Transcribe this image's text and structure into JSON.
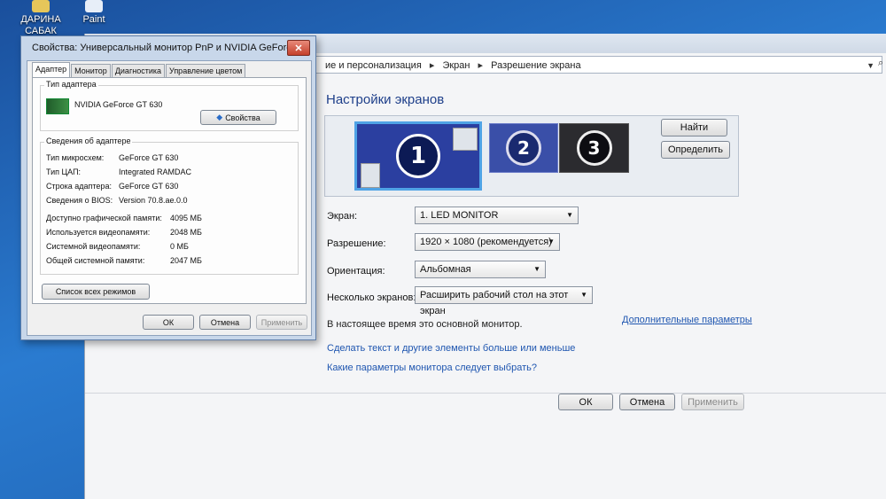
{
  "desktop": {
    "icons": [
      {
        "label": "ДАРИНА\nСАБАК",
        "name": "desktop-icon-user"
      },
      {
        "label": "Paint",
        "name": "desktop-icon-paint"
      }
    ]
  },
  "breadcrumb": {
    "item1": "ие и персонализация",
    "item2": "Экран",
    "item3": "Разрешение экрана",
    "sep": "▸"
  },
  "main": {
    "header": "Настройки экранов",
    "monitors": [
      "1",
      "2",
      "3"
    ],
    "find_button": "Найти",
    "identify_button": "Определить",
    "rows": {
      "display_label": "Экран:",
      "display_value": "1. LED MONITOR",
      "resolution_label": "Разрешение:",
      "resolution_value": "1920 × 1080 (рекомендуется)",
      "orientation_label": "Ориентация:",
      "orientation_value": "Альбомная",
      "multi_label": "Несколько экранов:",
      "multi_value": "Расширить рабочий стол на этот экран"
    },
    "primary_text": "В настоящее время это основной монитор.",
    "advanced_link": "Дополнительные параметры",
    "link1": "Сделать текст и другие элементы больше или меньше",
    "link2": "Какие параметры монитора следует выбрать?",
    "ok": "ОК",
    "cancel": "Отмена",
    "apply": "Применить"
  },
  "dialog": {
    "title": "Свойства: Универсальный монитор PnP и NVIDIA GeForce ...",
    "close": "✕",
    "tabs": [
      "Адаптер",
      "Монитор",
      "Диагностика",
      "Управление цветом"
    ],
    "adapter_type_title": "Тип адаптера",
    "adapter_name": "NVIDIA GeForce GT 630",
    "properties_button": "Свойства",
    "info_title": "Сведения об адаптере",
    "info": [
      {
        "k": "Тип микросхем:",
        "v": "GeForce GT 630"
      },
      {
        "k": "Тип ЦАП:",
        "v": "Integrated RAMDAC"
      },
      {
        "k": "Строка адаптера:",
        "v": "GeForce GT 630"
      },
      {
        "k": "Сведения о BIOS:",
        "v": "Version 70.8.ae.0.0"
      }
    ],
    "memory": [
      {
        "k": "Доступно графической памяти:",
        "v": "4095 МБ"
      },
      {
        "k": "Используется видеопамяти:",
        "v": "2048 МБ"
      },
      {
        "k": "Системной видеопамяти:",
        "v": "0 МБ"
      },
      {
        "k": "Общей системной памяти:",
        "v": "2047 МБ"
      }
    ],
    "list_modes_button": "Список всех режимов",
    "ok": "ОК",
    "cancel": "Отмена",
    "apply": "Применить"
  }
}
